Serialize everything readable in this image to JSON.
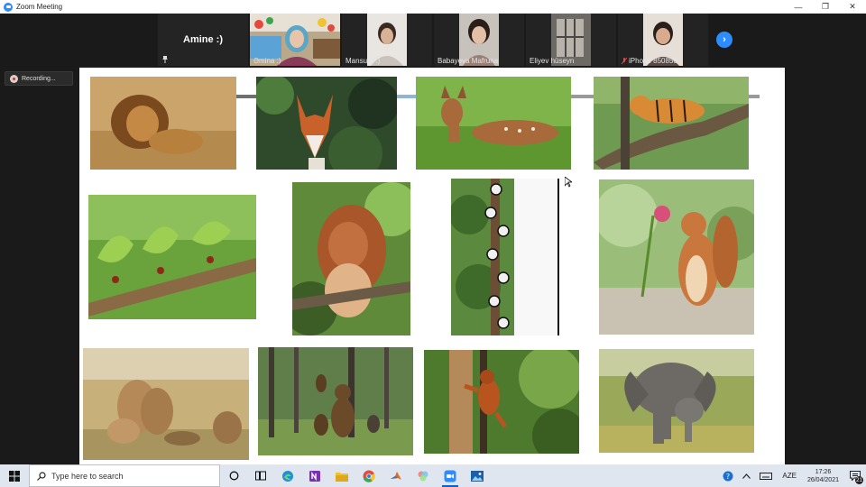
{
  "window": {
    "title": "Zoom Meeting"
  },
  "gallery": {
    "speaker_name": "Amine :)",
    "participants": [
      {
        "name": "Əmina :)"
      },
      {
        "name": "Mansura :)"
      },
      {
        "name": "Babayeva Mafruna"
      },
      {
        "name": "Eliyev hüseyn"
      },
      {
        "name": "iPhone 850850"
      }
    ]
  },
  "recording": {
    "label": "Recording..."
  },
  "shared_screen": {
    "photos": [
      {
        "subject": "lion"
      },
      {
        "subject": "fox"
      },
      {
        "subject": "deer fawn"
      },
      {
        "subject": "tiger on branch"
      },
      {
        "subject": "leafcutter ants"
      },
      {
        "subject": "squirrel eating"
      },
      {
        "subject": "pandas on tree"
      },
      {
        "subject": "squirrel with flower"
      },
      {
        "subject": "lion cubs"
      },
      {
        "subject": "bears in forest"
      },
      {
        "subject": "orangutan"
      },
      {
        "subject": "elephants"
      }
    ]
  },
  "taskbar": {
    "search_placeholder": "Type here to search",
    "language": "AZE",
    "time": "17:26",
    "date": "26/04/2021",
    "notification_count": "21"
  }
}
